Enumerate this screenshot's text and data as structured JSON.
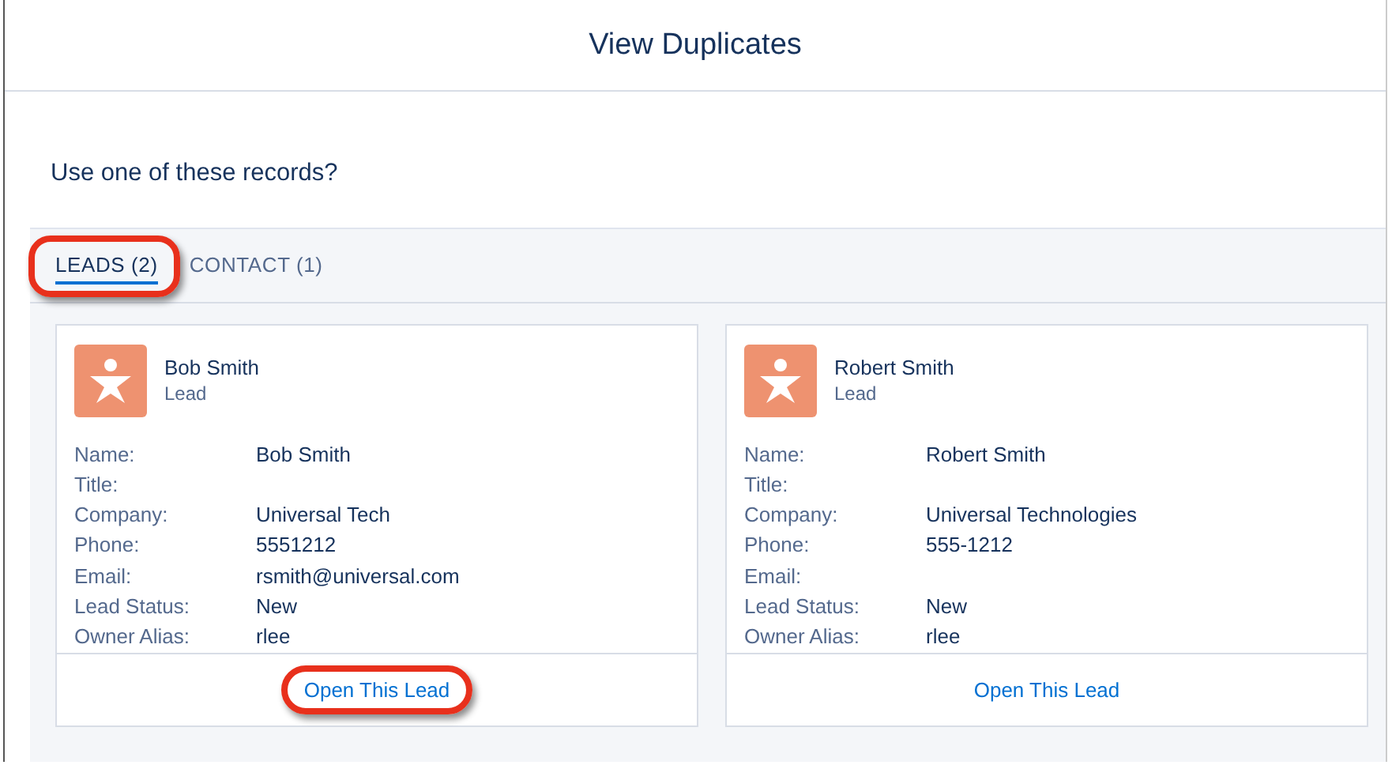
{
  "dialog": {
    "title": "View Duplicates"
  },
  "prompt": "Use one of these records?",
  "tabs": [
    {
      "label": "LEADS (2)",
      "selected": true,
      "highlighted": true
    },
    {
      "label": "CONTACT (1)",
      "selected": false,
      "highlighted": false
    }
  ],
  "records": [
    {
      "name": "Bob Smith",
      "type": "Lead",
      "fields": [
        {
          "label": "Name:",
          "value": "Bob Smith"
        },
        {
          "label": "Title:"
        },
        {
          "label": "Company:",
          "value": "Universal Tech"
        },
        {
          "label": "Phone:",
          "value": "5551212"
        },
        {
          "label": "Email:",
          "value": "rsmith@universal.com"
        },
        {
          "label": "Lead Status:",
          "value": "New"
        },
        {
          "label": "Owner Alias:",
          "value": "rlee"
        }
      ],
      "action": {
        "label": "Open This Lead",
        "highlighted": true
      }
    },
    {
      "name": "Robert Smith",
      "type": "Lead",
      "fields": [
        {
          "label": "Name:",
          "value": "Robert Smith"
        },
        {
          "label": "Title:"
        },
        {
          "label": "Company:",
          "value": "Universal Technologies"
        },
        {
          "label": "Phone:",
          "value": "555-1212"
        },
        {
          "label": "Email:"
        },
        {
          "label": "Lead Status:",
          "value": "New"
        },
        {
          "label": "Owner Alias:",
          "value": "rlee"
        }
      ],
      "action": {
        "label": "Open This Lead",
        "highlighted": false
      }
    }
  ]
}
